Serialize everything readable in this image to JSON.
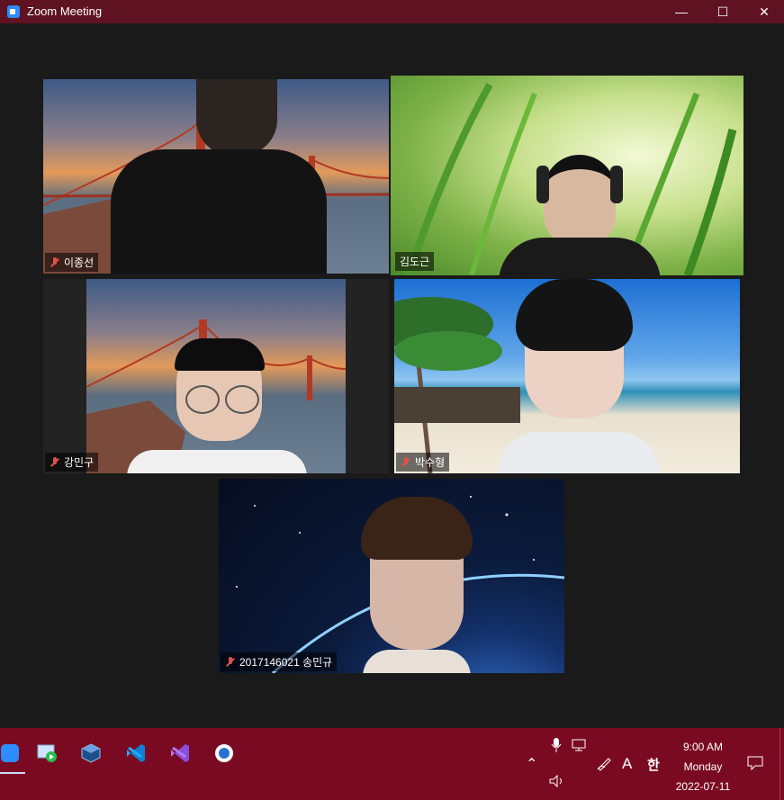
{
  "window": {
    "title": "Zoom Meeting"
  },
  "participants": [
    {
      "name": "이종선",
      "muted": true
    },
    {
      "name": "김도근",
      "muted": false,
      "active": true
    },
    {
      "name": "강민구",
      "muted": true
    },
    {
      "name": "박수형",
      "muted": true
    },
    {
      "name": "2017146021 송민규",
      "muted": true
    }
  ],
  "tray": {
    "ime_letter": "A",
    "ime_mode": "한",
    "time": "9:00 AM",
    "day": "Monday",
    "date": "2022-07-11"
  },
  "colors": {
    "titlebar": "#5f1322",
    "taskbar": "#7a0a22",
    "active_speaker_border": "#dff36b",
    "muted": "#e0504d"
  }
}
